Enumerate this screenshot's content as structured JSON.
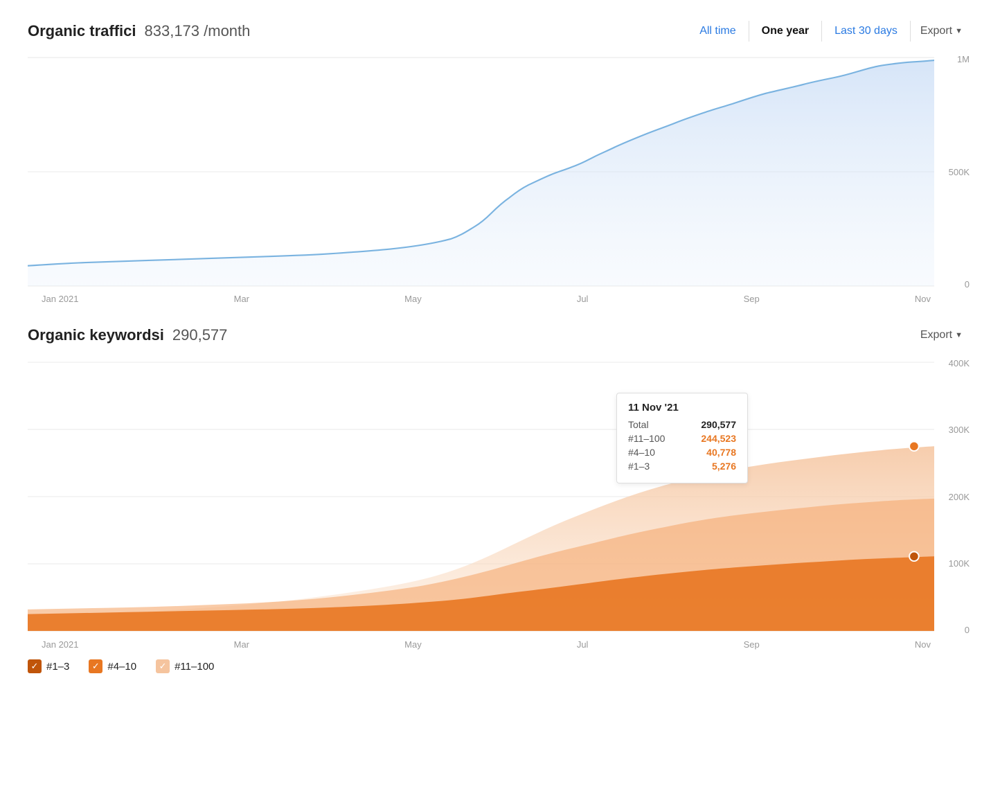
{
  "traffic": {
    "title": "Organic traffic",
    "info": "i",
    "metric": "833,173 /month",
    "filters": [
      "All time",
      "One year",
      "Last 30 days"
    ],
    "active_filter": "One year",
    "export_label": "Export",
    "y_labels": [
      "1M",
      "500K",
      "0"
    ],
    "x_labels": [
      "Jan 2021",
      "Mar",
      "May",
      "Jul",
      "Sep",
      "Nov"
    ]
  },
  "keywords": {
    "title": "Organic keywords",
    "info": "i",
    "metric": "290,577",
    "export_label": "Export",
    "y_labels": [
      "400K",
      "300K",
      "200K",
      "100K",
      "0"
    ],
    "x_labels": [
      "Jan 2021",
      "Mar",
      "May",
      "Jul",
      "Sep",
      "Nov"
    ],
    "tooltip": {
      "date": "11 Nov '21",
      "rows": [
        {
          "label": "Total",
          "value": "290,577",
          "color": "black"
        },
        {
          "label": "#11–100",
          "value": "244,523",
          "color": "orange"
        },
        {
          "label": "#4–10",
          "value": "40,778",
          "color": "orange"
        },
        {
          "label": "#1–3",
          "value": "5,276",
          "color": "orange"
        }
      ]
    },
    "legend": [
      {
        "label": "#1–3",
        "color": "#c0550a"
      },
      {
        "label": "#4–10",
        "color": "#e87722"
      },
      {
        "label": "#11–100",
        "color": "#f5c49e"
      }
    ]
  },
  "colors": {
    "blue_line": "#7ab3e0",
    "blue_fill": "#ddeaf8",
    "orange_dark": "#c0550a",
    "orange_mid": "#e87722",
    "orange_light": "#f5c49e",
    "orange_fill": "#fce8d6",
    "accent_blue": "#2a7ae2"
  }
}
